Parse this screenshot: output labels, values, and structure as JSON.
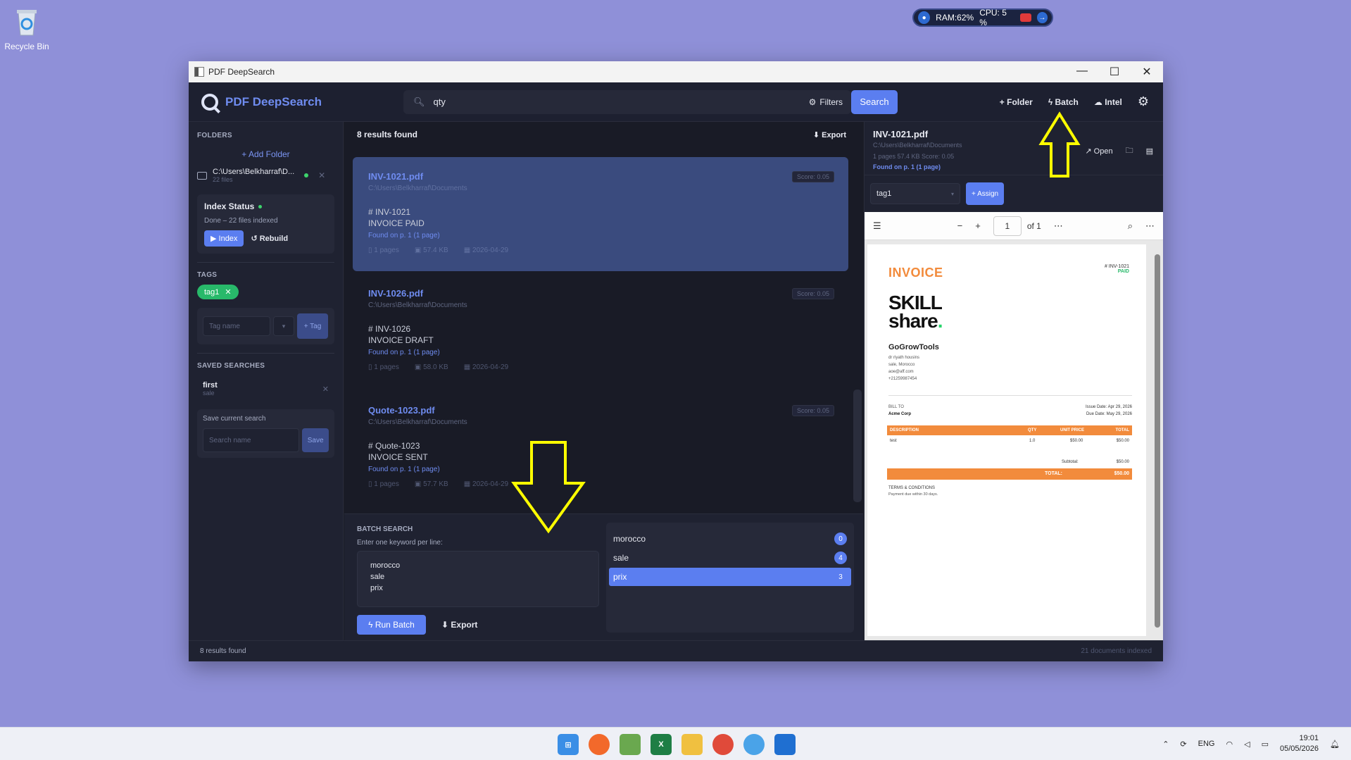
{
  "desktop": {
    "recycle_bin_label": "Recycle Bin",
    "widget": {
      "ram": "RAM:62%",
      "cpu": "CPU: 5 %"
    }
  },
  "window": {
    "title": "PDF DeepSearch",
    "controls": {
      "minimize": "—",
      "maximize": "☐",
      "close": "✕"
    }
  },
  "header": {
    "brand": "PDF DeepSearch",
    "search_value": "qty",
    "filters_label": "Filters",
    "search_button": "Search",
    "add_folder": "+ Folder",
    "batch": "Batch",
    "intel": "Intel"
  },
  "sidebar": {
    "folders_title": "FOLDERS",
    "add_folder": "+ Add Folder",
    "folder": {
      "path": "C:\\Users\\Belkharraf\\D...",
      "files": "22 files"
    },
    "index": {
      "title": "Index Status",
      "status": "Done – 22 files indexed",
      "index_btn": "▶ Index",
      "rebuild_btn": "↺ Rebuild"
    },
    "tags_title": "TAGS",
    "tag": "tag1",
    "tag_placeholder": "Tag name",
    "tag_select": "▾",
    "tag_button": "+ Tag",
    "saved_title": "SAVED SEARCHES",
    "saved": {
      "name": "first",
      "query": "sale"
    },
    "save_label": "Save current search",
    "save_placeholder": "Search name",
    "save_button": "Save"
  },
  "results": {
    "count": "8 results found",
    "export": "⬇ Export",
    "items": [
      {
        "title": "INV-1021.pdf",
        "path": "C:\\Users\\Belkharraf\\Documents",
        "score": "Score: 0.05",
        "line1": "# INV-1021",
        "line2": "INVOICE PAID",
        "found": "Found on p. 1 (1 page)",
        "pages": "1 pages",
        "size": "57.4 KB",
        "date": "2026-04-29"
      },
      {
        "title": "INV-1026.pdf",
        "path": "C:\\Users\\Belkharraf\\Documents",
        "score": "Score: 0.05",
        "line1": "# INV-1026",
        "line2": "INVOICE DRAFT",
        "found": "Found on p. 1 (1 page)",
        "pages": "1 pages",
        "size": "58.0 KB",
        "date": "2026-04-29"
      },
      {
        "title": "Quote-1023.pdf",
        "path": "C:\\Users\\Belkharraf\\Documents",
        "score": "Score: 0.05",
        "line1": "# Quote-1023",
        "line2": "INVOICE SENT",
        "found": "Found on p. 1 (1 page)",
        "pages": "1 pages",
        "size": "57.7 KB",
        "date": "2026-04-29"
      }
    ]
  },
  "batch": {
    "title": "BATCH SEARCH",
    "hint": "Enter one keyword per line:",
    "keywords": [
      "morocco",
      "sale",
      "prix"
    ],
    "run": "Run Batch",
    "export": "⬇ Export",
    "results": [
      {
        "keyword": "morocco",
        "count": "0"
      },
      {
        "keyword": "sale",
        "count": "4"
      },
      {
        "keyword": "prix",
        "count": "3"
      }
    ]
  },
  "preview": {
    "title": "INV-1021.pdf",
    "path": "C:\\Users\\Belkharraf\\Documents",
    "meta": "1 pages   57.4 KB   Score: 0.05",
    "found": "Found on p. 1 (1 page)",
    "open": "↗ Open",
    "tag_value": "tag1",
    "assign": "+ Assign",
    "page_num": "1",
    "page_of": "of 1"
  },
  "invoice": {
    "heading": "INVOICE",
    "number": "# INV-1021",
    "status": "PAID",
    "logo_line1": "SKILL",
    "logo_line2": "share",
    "company": "GoGrowTools",
    "company_lines": [
      "dr riyath housins",
      "sale, Morocco",
      "aoe@aff.com",
      "+21259987454"
    ],
    "bill_to_label": "BILL TO",
    "bill_to": "Acme Corp",
    "issue_date": "Issue Date: Apr 29, 2026",
    "due_date": "Due Date: May 29, 2026",
    "cols": [
      "DESCRIPTION",
      "QTY",
      "UNIT PRICE",
      "TOTAL"
    ],
    "row": [
      "test",
      "1.0",
      "$50.00",
      "$50.00"
    ],
    "subtotal_label": "Subtotal:",
    "subtotal": "$50.00",
    "total_label": "TOTAL:",
    "total": "$50.00",
    "terms_label": "TERMS & CONDITIONS",
    "terms": "Payment due within 30 days."
  },
  "status": {
    "left": "8 results found",
    "right": "21 documents indexed"
  },
  "taskbar": {
    "lang": "ENG",
    "time": "19:01",
    "date": "05/05/2026"
  },
  "colors": {
    "accent": "#5b7ef0",
    "annotation": "#ffff00",
    "invoice_orange": "#f28b3c",
    "tag_green": "#28b96a"
  }
}
